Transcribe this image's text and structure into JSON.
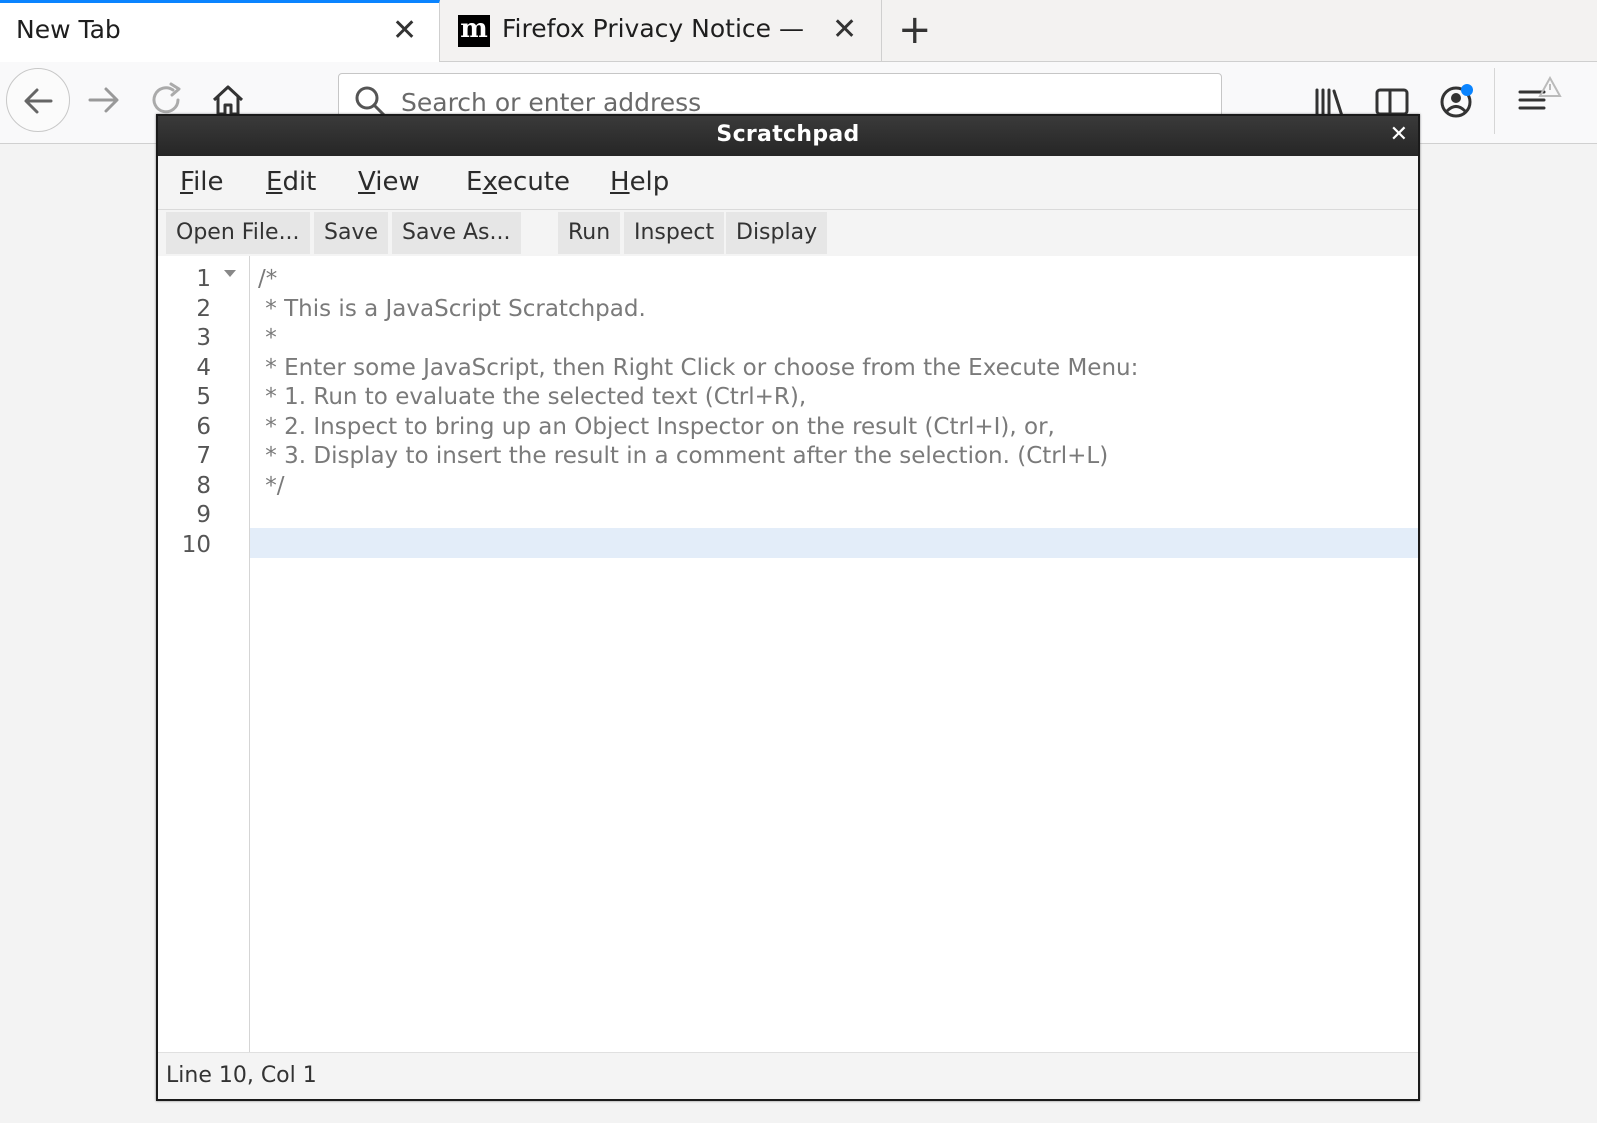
{
  "tabs": [
    {
      "label": "New Tab",
      "active": true
    },
    {
      "label": "Firefox Privacy Notice —",
      "favicon": "m",
      "active": false
    }
  ],
  "navbar": {
    "url_placeholder": "Search or enter address"
  },
  "scratchpad": {
    "title": "Scratchpad",
    "menus": {
      "file": {
        "acc": "F",
        "rest": "ile"
      },
      "edit": {
        "acc": "E",
        "rest": "dit"
      },
      "view": {
        "acc": "V",
        "rest": "iew"
      },
      "execute": {
        "pre": "E",
        "acc": "x",
        "rest": "ecute"
      },
      "help": {
        "acc": "H",
        "rest": "elp"
      }
    },
    "toolbar": {
      "open": "Open File...",
      "save": "Save",
      "save_as": "Save As...",
      "run": "Run",
      "inspect": "Inspect",
      "display": "Display"
    },
    "line_numbers": [
      "1",
      "2",
      "3",
      "4",
      "5",
      "6",
      "7",
      "8",
      "9",
      "10"
    ],
    "code_lines": [
      "/*",
      " * This is a JavaScript Scratchpad.",
      " *",
      " * Enter some JavaScript, then Right Click or choose from the Execute Menu:",
      " * 1. Run to evaluate the selected text (Ctrl+R),",
      " * 2. Inspect to bring up an Object Inspector on the result (Ctrl+I), or,",
      " * 3. Display to insert the result in a comment after the selection. (Ctrl+L)",
      " */",
      "",
      ""
    ],
    "status": "Line 10, Col 1"
  },
  "colors": {
    "active_tab_accent": "#0a84ff",
    "active_line": "#e3edf9",
    "titlebar": "#262626"
  },
  "icons": [
    "close-icon",
    "plus-icon",
    "back-arrow-icon",
    "forward-arrow-icon",
    "reload-icon",
    "home-icon",
    "search-icon",
    "library-icon",
    "sidebar-icon",
    "account-icon",
    "menu-icon"
  ]
}
